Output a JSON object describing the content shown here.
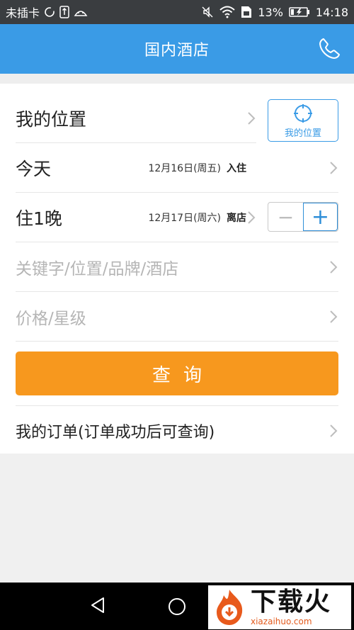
{
  "status_bar": {
    "carrier": "未插卡",
    "battery": "13%",
    "time": "14:18"
  },
  "header": {
    "title": "国内酒店",
    "phone_icon": "phone-icon"
  },
  "form": {
    "location_label": "我的位置",
    "location_button_label": "我的位置",
    "checkin_label": "今天",
    "checkin_date": "12月16日(周五)",
    "checkin_tag": "入住",
    "nights_label": "住1晚",
    "checkout_date": "12月17日(周六)",
    "checkout_tag": "离店",
    "stepper_minus": "−",
    "stepper_plus": "+",
    "keyword_placeholder": "关键字/位置/品牌/酒店",
    "price_placeholder": "价格/星级",
    "query_button": "查询",
    "orders_label": "我的订单(订单成功后可查询)"
  },
  "watermark": {
    "cn": "下载火",
    "en": "xiazaihuo.com"
  },
  "colors": {
    "primary": "#3a9be6",
    "accent": "#f7981e"
  }
}
